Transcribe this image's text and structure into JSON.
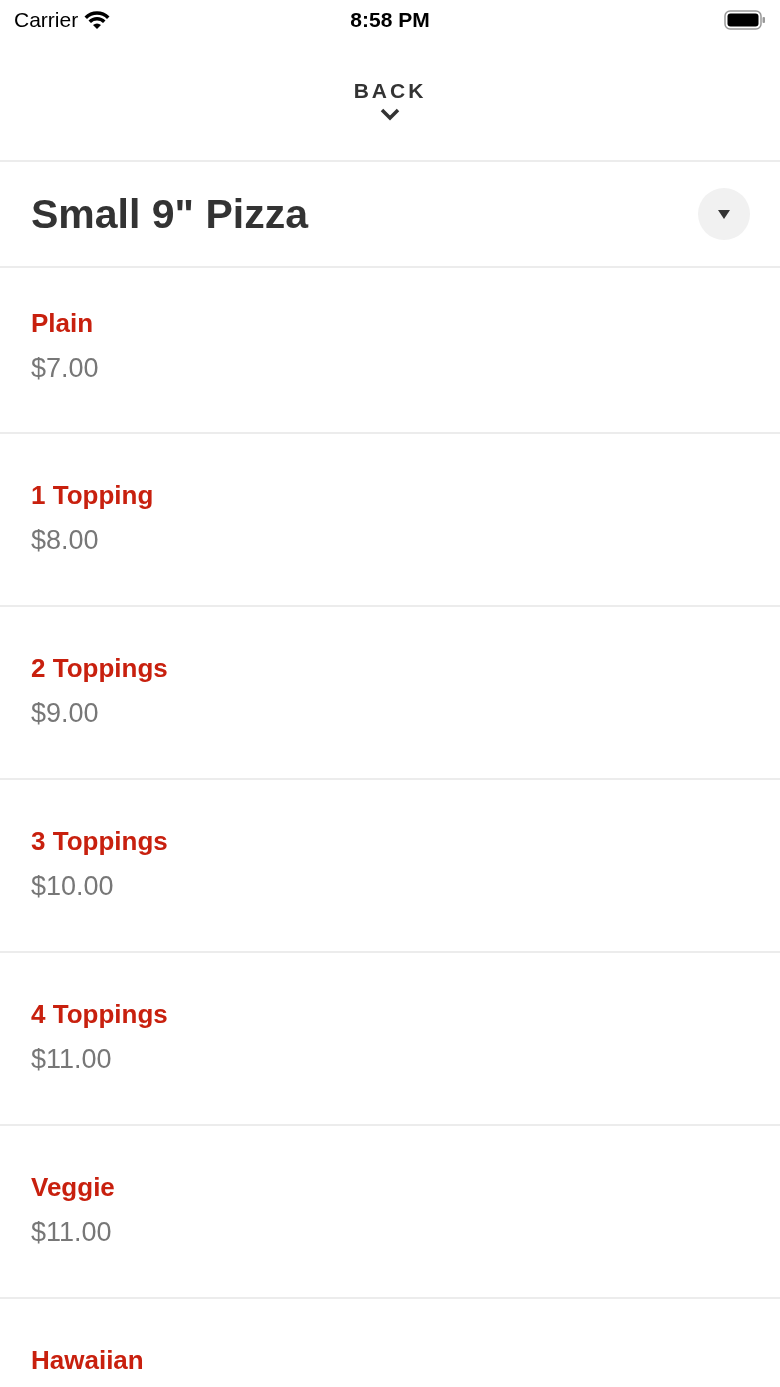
{
  "status_bar": {
    "carrier": "Carrier",
    "time": "8:58 PM"
  },
  "nav": {
    "back": "BACK"
  },
  "header": {
    "title": "Small 9\" Pizza"
  },
  "items": [
    {
      "name": "Plain",
      "price": "$7.00"
    },
    {
      "name": "1 Topping",
      "price": "$8.00"
    },
    {
      "name": "2 Toppings",
      "price": "$9.00"
    },
    {
      "name": "3 Toppings",
      "price": "$10.00"
    },
    {
      "name": "4 Toppings",
      "price": "$11.00"
    },
    {
      "name": "Veggie",
      "price": "$11.00"
    },
    {
      "name": "Hawaiian"
    }
  ]
}
